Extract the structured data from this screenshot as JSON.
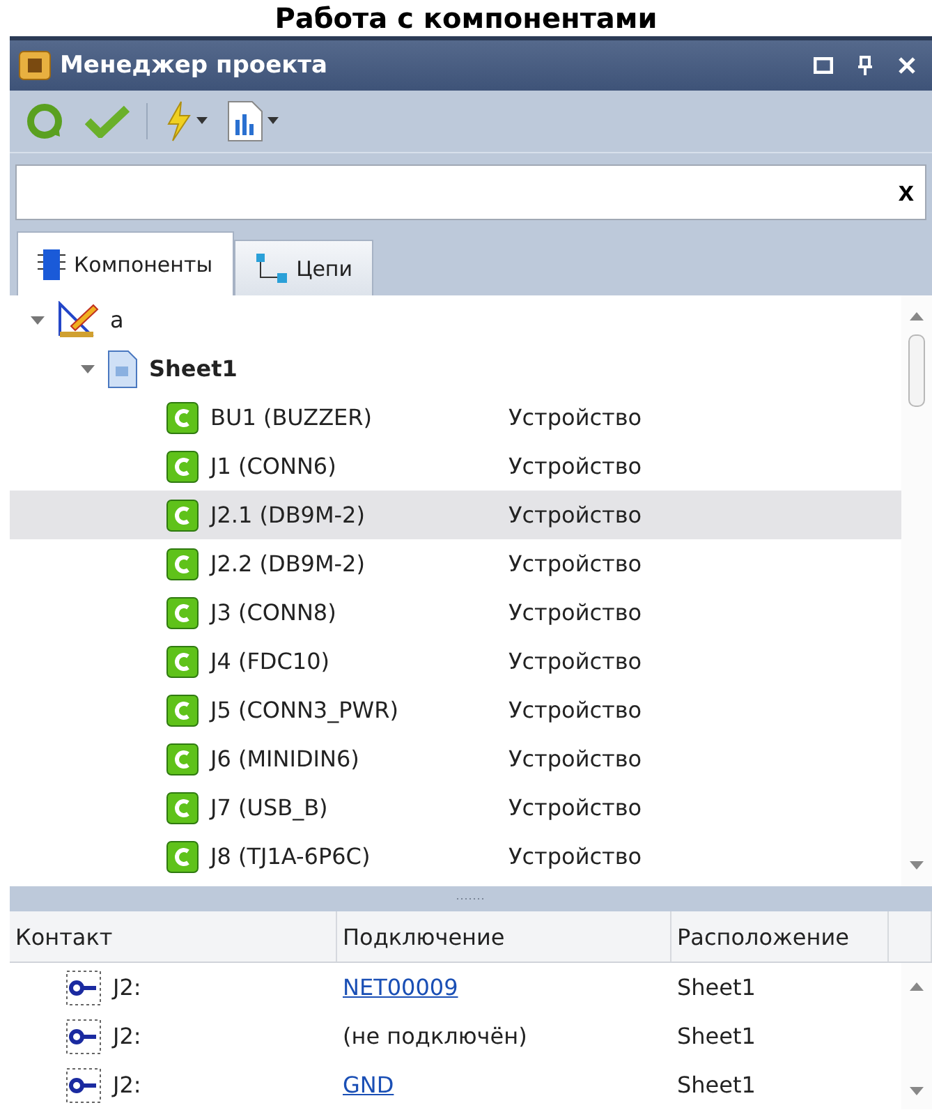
{
  "heading": "Работа с компонентами",
  "window": {
    "title": "Менеджер проекта"
  },
  "search": {
    "clear": "x"
  },
  "tabs": [
    {
      "label": "Компоненты",
      "kind": "components",
      "selected": true
    },
    {
      "label": "Цепи",
      "kind": "nets",
      "selected": false
    }
  ],
  "tree": [
    {
      "label": "a",
      "kind": "project",
      "expanded": true,
      "children": [
        {
          "label": "Sheet1",
          "kind": "sheet",
          "expanded": true,
          "children": [
            {
              "label": "BU1 (BUZZER)",
              "type": "Устройство",
              "selected": false
            },
            {
              "label": "J1 (CONN6)",
              "type": "Устройство",
              "selected": false
            },
            {
              "label": "J2.1 (DB9M-2)",
              "type": "Устройство",
              "selected": true
            },
            {
              "label": "J2.2 (DB9M-2)",
              "type": "Устройство",
              "selected": false
            },
            {
              "label": "J3 (CONN8)",
              "type": "Устройство",
              "selected": false
            },
            {
              "label": "J4 (FDC10)",
              "type": "Устройство",
              "selected": false
            },
            {
              "label": "J5 (CONN3_PWR)",
              "type": "Устройство",
              "selected": false
            },
            {
              "label": "J6 (MINIDIN6)",
              "type": "Устройство",
              "selected": false
            },
            {
              "label": "J7 (USB_B)",
              "type": "Устройство",
              "selected": false
            },
            {
              "label": "J8 (TJ1A-6P6C)",
              "type": "Устройство",
              "selected": false
            }
          ]
        }
      ]
    }
  ],
  "pins": {
    "columns": [
      "Контакт",
      "Подключение",
      "Расположение"
    ],
    "rows": [
      {
        "contact": "J2:",
        "connection": "NET00009",
        "link": true,
        "location": "Sheet1"
      },
      {
        "contact": "J2:",
        "connection": "(не подключён)",
        "link": false,
        "location": "Sheet1"
      },
      {
        "contact": "J2:",
        "connection": "GND",
        "link": true,
        "location": "Sheet1"
      }
    ]
  }
}
